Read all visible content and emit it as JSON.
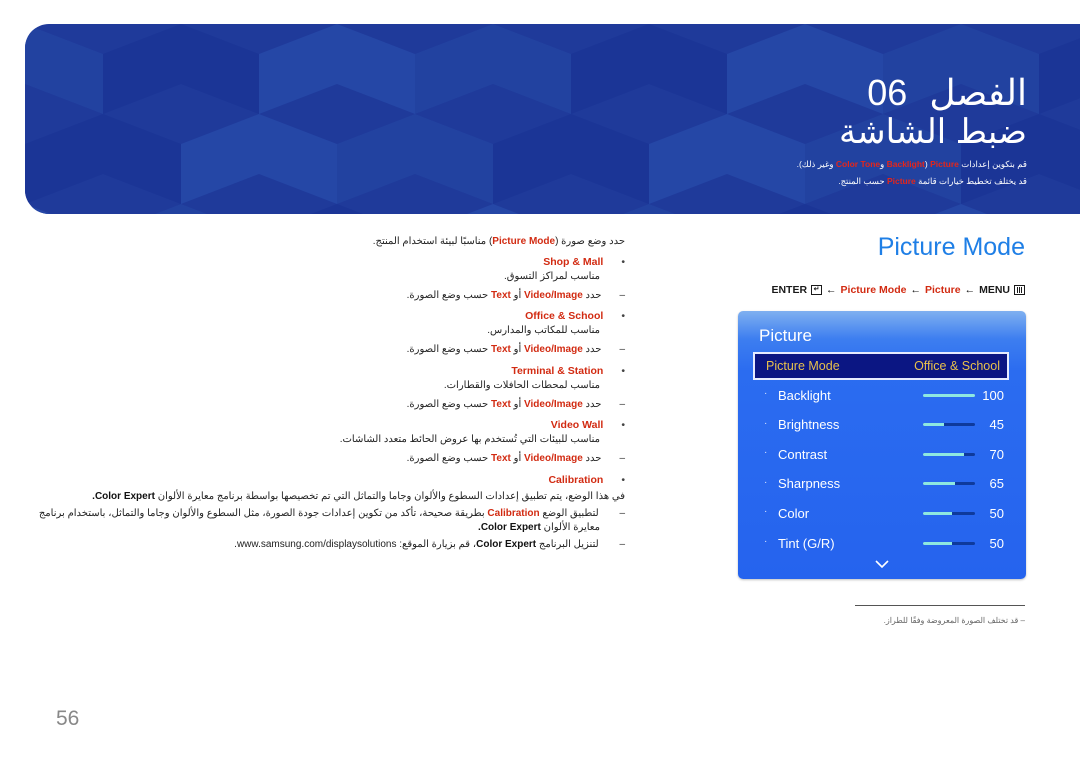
{
  "banner": {
    "chapter_label": "الفصل",
    "chapter_number": "06",
    "title": "ضبط الشاشة",
    "desc_line1": {
      "pre": "قم بتكوين إعدادات",
      "h1": "Picture",
      "mid1": "(",
      "h2": "Backlight",
      "mid2": "و",
      "h3": "Color Tone",
      "post": "وغير ذلك)."
    },
    "desc_line2": {
      "pre": "قد يختلف تخطيط خيارات قائمة",
      "h1": "Picture",
      "post": "حسب المنتج."
    },
    "colors": {
      "base": "#1f3a9a",
      "highlight": "#e4261b"
    }
  },
  "section": {
    "title": "Picture Mode",
    "nav": {
      "enter": "ENTER",
      "arrow": "←",
      "picture_mode": "Picture Mode",
      "picture": "Picture",
      "menu": "MENU",
      "enter_icon": "enter-icon",
      "menu_icon": "menu-icon"
    }
  },
  "osd": {
    "title": "Picture",
    "selected": {
      "label": "Picture Mode",
      "value": "Office & School"
    },
    "items": [
      {
        "label": "Backlight",
        "value": "100",
        "fraction": 1.0
      },
      {
        "label": "Brightness",
        "value": "45",
        "fraction": 0.4
      },
      {
        "label": "Contrast",
        "value": "70",
        "fraction": 0.78
      },
      {
        "label": "Sharpness",
        "value": "65",
        "fraction": 0.62
      },
      {
        "label": "Color",
        "value": "50",
        "fraction": 0.55
      },
      {
        "label": "Tint (G/R)",
        "value": "50",
        "fraction": 0.55
      }
    ],
    "more_icon": "chevron-down-icon"
  },
  "right_note": "قد تختلف الصورة المعروضة وفقًا للطراز.",
  "content": {
    "intro": {
      "pre": "حدد وضع صورة (",
      "hl": "Picture Mode",
      "post": ") مناسبًا لبيئة استخدام المنتج."
    },
    "dash_mark": "–",
    "bullet_mark": "•",
    "modes": [
      {
        "name": "Shop & Mall",
        "desc": "مناسب لمراكز التسوق.",
        "sub": {
          "pre": "حدد",
          "h1": "Video/Image",
          "mid": "أو",
          "h2": "Text",
          "post": "حسب وضع الصورة."
        }
      },
      {
        "name": "Office & School",
        "desc": "مناسب للمكاتب والمدارس.",
        "sub": {
          "pre": "حدد",
          "h1": "Video/Image",
          "mid": "أو",
          "h2": "Text",
          "post": "حسب وضع الصورة."
        }
      },
      {
        "name": "Terminal & Station",
        "desc": "مناسب لمحطات الحافلات والقطارات.",
        "sub": {
          "pre": "حدد",
          "h1": "Video/Image",
          "mid": "أو",
          "h2": "Text",
          "post": "حسب وضع الصورة."
        }
      },
      {
        "name": "Video Wall",
        "desc": "مناسب للبيئات التي تُستخدم بها عروض الحائط متعدد الشاشات.",
        "sub": {
          "pre": "حدد",
          "h1": "Video/Image",
          "mid": "أو",
          "h2": "Text",
          "post": "حسب وضع الصورة."
        }
      }
    ],
    "calibration": {
      "name": "Calibration",
      "desc": {
        "pre": "في هذا الوضع، يتم تطبيق إعدادات السطوع والألوان وجاما والتماثل التي تم تخصيصها بواسطة برنامج معايرة الألوان",
        "b": "Color Expert",
        "post": "."
      },
      "note1_line1": {
        "pre": "لتطبيق الوضع",
        "hl": "Calibration",
        "post": "بطريقة صحيحة، تأكد من تكوين إعدادات جودة الصورة، مثل السطوع والألوان وجاما والتماثل، باستخدام برنامج"
      },
      "note1_line2": {
        "pre": "معايرة الألوان",
        "b": "Color Expert",
        "post": "."
      },
      "note2": {
        "pre": "لتنزيل البرنامج",
        "b": "Color Expert",
        "post": "، قم بزيارة الموقع: www.samsung.com/displaysolutions."
      }
    }
  },
  "page_number": "56"
}
